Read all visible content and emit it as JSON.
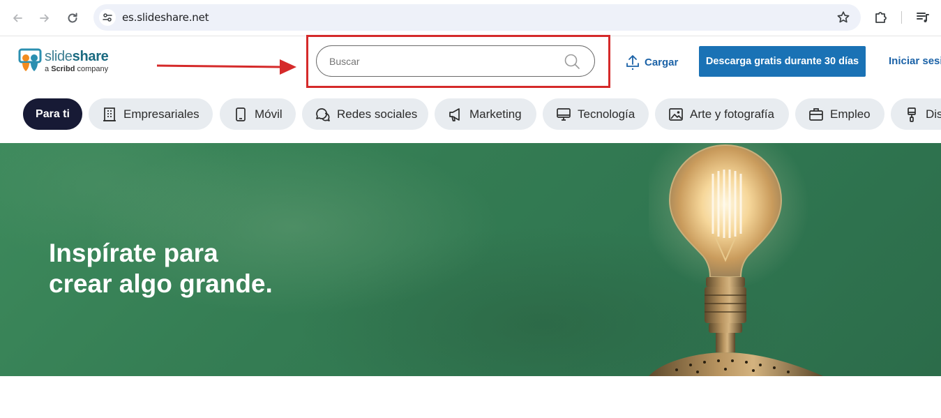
{
  "browser": {
    "url": "es.slideshare.net"
  },
  "logo": {
    "word_part1": "slide",
    "word_part2": "share",
    "sub_prefix": "a ",
    "sub_brand": "Scribd",
    "sub_suffix": " company"
  },
  "search": {
    "placeholder": "Buscar"
  },
  "header": {
    "upload_label": "Cargar",
    "cta_label": "Descarga gratis durante 30 días",
    "login_label": "Iniciar sesión"
  },
  "categories": [
    {
      "label": "Para ti",
      "icon": "none",
      "active": true
    },
    {
      "label": "Empresariales",
      "icon": "building-icon"
    },
    {
      "label": "Móvil",
      "icon": "phone-icon"
    },
    {
      "label": "Redes sociales",
      "icon": "chat-bubbles-icon"
    },
    {
      "label": "Marketing",
      "icon": "megaphone-icon"
    },
    {
      "label": "Tecnología",
      "icon": "monitor-icon"
    },
    {
      "label": "Arte y fotografía",
      "icon": "image-icon"
    },
    {
      "label": "Empleo",
      "icon": "briefcase-icon"
    },
    {
      "label": "Diseño",
      "icon": "paint-brush-icon"
    }
  ],
  "hero": {
    "title_line1": "Inspírate para",
    "title_line2": "crear algo grande."
  },
  "colors": {
    "cta_blue": "#1a72b5",
    "link_blue": "#1b62a7",
    "active_chip": "#171a35",
    "hero_green": "#347c53",
    "highlight_red": "#d52a2a"
  }
}
